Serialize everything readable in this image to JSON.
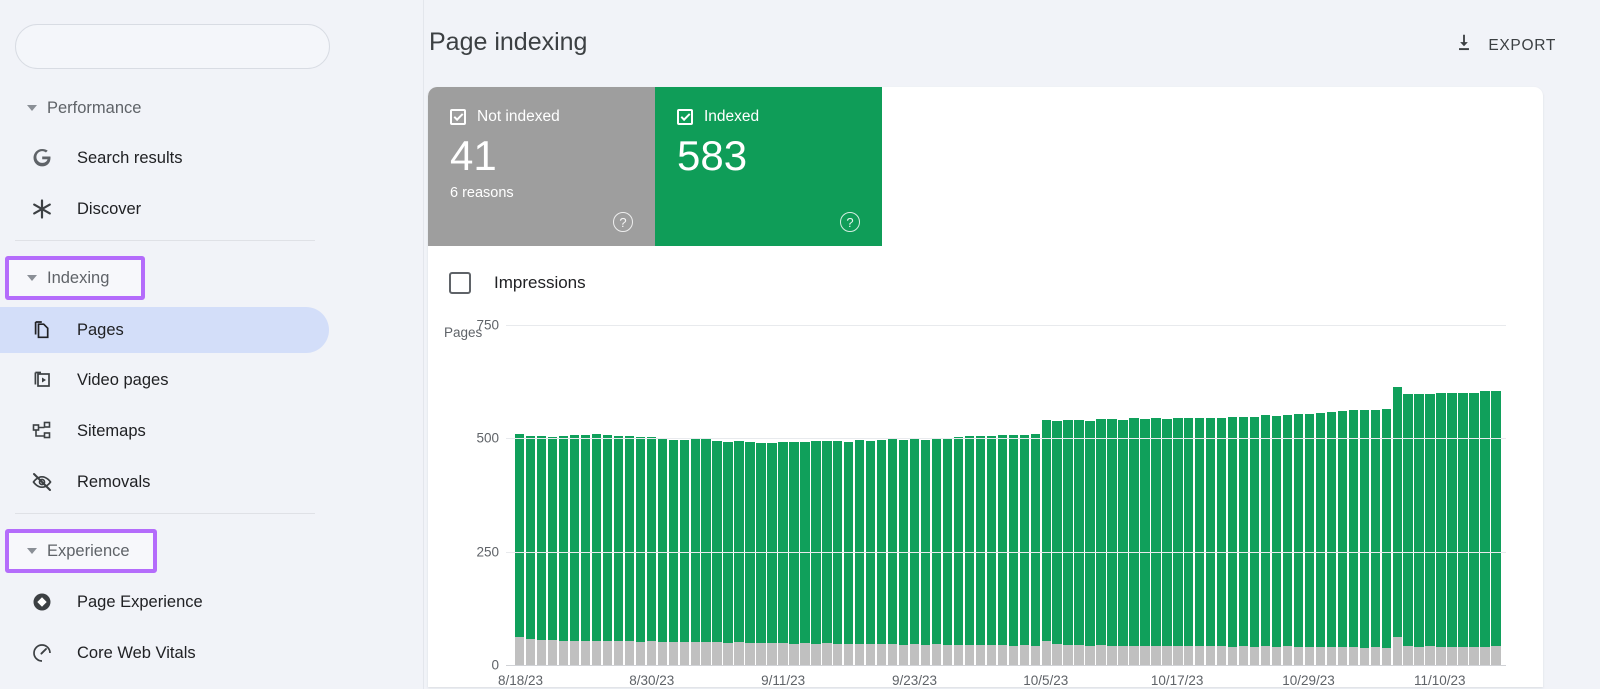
{
  "sidebar": {
    "search": {
      "placeholder": "",
      "value": ""
    },
    "sections": [
      {
        "label": "Performance",
        "highlighted": false
      },
      {
        "label": "Indexing",
        "highlighted": true
      },
      {
        "label": "Experience",
        "highlighted": true
      }
    ],
    "items": [
      {
        "label": "Search results",
        "icon": "google-g-icon",
        "active": false
      },
      {
        "label": "Discover",
        "icon": "asterisk-icon",
        "active": false
      },
      {
        "label": "Pages",
        "icon": "pages-copy-icon",
        "active": true
      },
      {
        "label": "Video pages",
        "icon": "video-page-icon",
        "active": false
      },
      {
        "label": "Sitemaps",
        "icon": "sitemap-icon",
        "active": false
      },
      {
        "label": "Removals",
        "icon": "eye-off-icon",
        "active": false
      },
      {
        "label": "Page Experience",
        "icon": "page-experience-icon",
        "active": false
      },
      {
        "label": "Core Web Vitals",
        "icon": "speedometer-icon",
        "active": false
      }
    ]
  },
  "header": {
    "title": "Page indexing",
    "export_label": "EXPORT"
  },
  "cards": [
    {
      "label": "Not indexed",
      "value": "41",
      "sub": "6 reasons",
      "color": "#9e9e9e",
      "checked": true,
      "help": "?"
    },
    {
      "label": "Indexed",
      "value": "583",
      "sub": "",
      "color": "#0f9d58",
      "checked": true,
      "help": "?"
    }
  ],
  "impressions": {
    "label": "Impressions",
    "checked": false
  },
  "chart_data": {
    "type": "bar",
    "stacked": true,
    "title": "",
    "xlabel": "",
    "ylabel": "Pages",
    "ylim": [
      0,
      750
    ],
    "yticks": [
      750,
      500,
      250,
      0
    ],
    "ytick_labels": [
      "750",
      "500",
      "250",
      "0"
    ],
    "grid": true,
    "legend_position": "top",
    "x_tick_labels": [
      "8/18/23",
      "8/30/23",
      "9/11/23",
      "9/23/23",
      "10/5/23",
      "10/17/23",
      "10/29/23",
      "11/10/23"
    ],
    "x_tick_indices": [
      0,
      12,
      24,
      36,
      48,
      60,
      72,
      84
    ],
    "series": [
      {
        "name": "Indexed",
        "color": "#10a05b",
        "values": [
          448,
          447,
          450,
          449,
          452,
          455,
          454,
          456,
          455,
          453,
          454,
          452,
          450,
          448,
          447,
          446,
          448,
          447,
          445,
          443,
          444,
          442,
          441,
          440,
          444,
          446,
          445,
          447,
          446,
          448,
          447,
          449,
          448,
          450,
          452,
          451,
          453,
          452,
          454,
          456,
          458,
          460,
          462,
          461,
          463,
          465,
          464,
          466,
          488,
          492,
          495,
          497,
          496,
          498,
          500,
          499,
          501,
          500,
          502,
          501,
          503,
          502,
          504,
          503,
          505,
          507,
          506,
          508,
          510,
          509,
          511,
          513,
          515,
          517,
          519,
          521,
          523,
          525,
          524,
          526,
          552,
          556,
          558,
          557,
          559,
          561,
          560,
          562,
          564,
          563
        ]
      },
      {
        "name": "Not indexed",
        "color": "#c0c0c0",
        "values": [
          62,
          58,
          56,
          55,
          54,
          53,
          54,
          53,
          52,
          53,
          52,
          51,
          52,
          51,
          50,
          51,
          50,
          51,
          50,
          49,
          50,
          49,
          48,
          49,
          48,
          47,
          48,
          47,
          48,
          47,
          46,
          47,
          46,
          47,
          46,
          45,
          46,
          45,
          46,
          45,
          44,
          45,
          44,
          45,
          44,
          43,
          44,
          43,
          52,
          47,
          45,
          44,
          43,
          44,
          43,
          42,
          43,
          42,
          43,
          42,
          41,
          42,
          41,
          42,
          41,
          40,
          41,
          40,
          41,
          40,
          41,
          40,
          39,
          40,
          39,
          40,
          39,
          38,
          39,
          38,
          62,
          42,
          40,
          41,
          40,
          39,
          40,
          39,
          40,
          41
        ]
      }
    ]
  }
}
